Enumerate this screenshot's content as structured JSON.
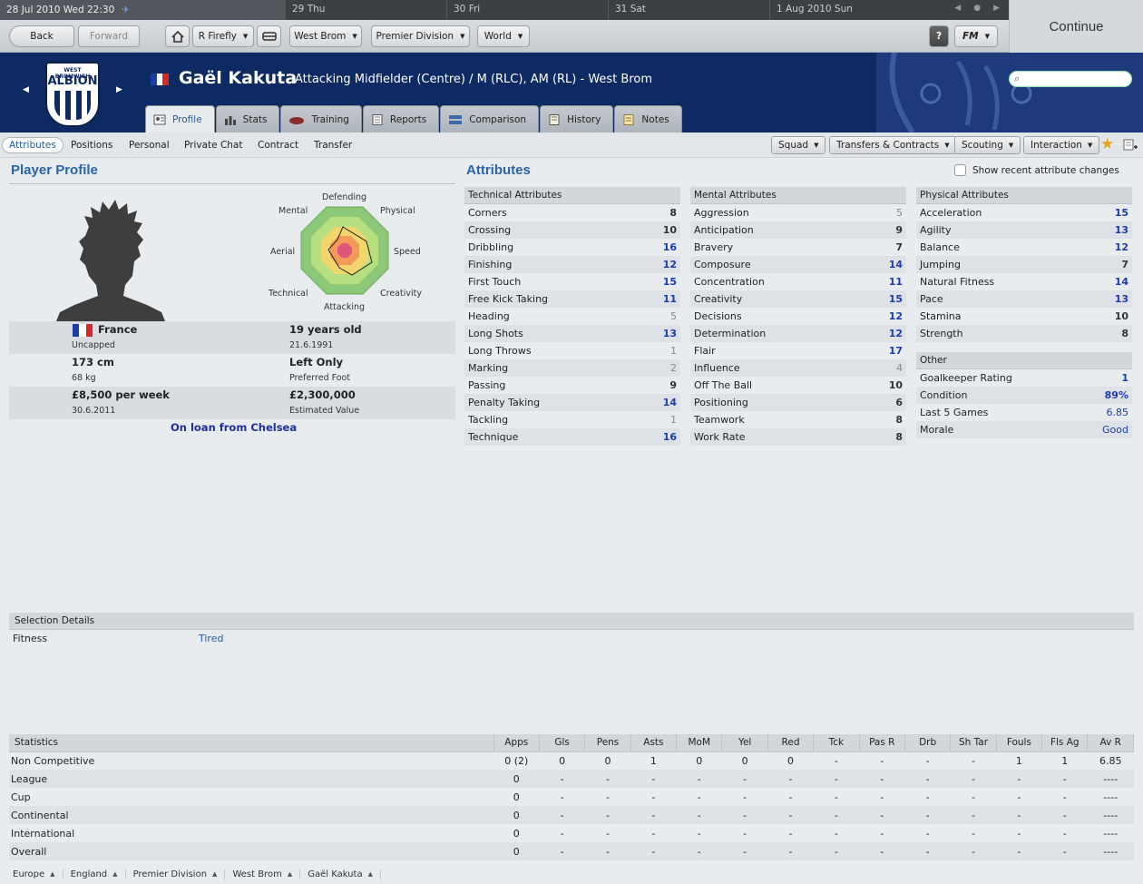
{
  "datebar": {
    "current": "28 Jul 2010 Wed 22:30",
    "days": [
      "29 Thu",
      "30 Fri",
      "31 Sat",
      "1 Aug 2010 Sun"
    ]
  },
  "continue_label": "Continue",
  "toolbar": {
    "back": "Back",
    "forward": "Forward",
    "manager": "R Firefly",
    "club": "West Brom",
    "league": "Premier Division",
    "world": "World",
    "help": "?",
    "fm": "FM"
  },
  "header": {
    "crest_top": "WEST BROMWICH",
    "crest_name": "ALBION",
    "player_name": "Gaël Kakuta",
    "position": "Attacking Midfielder (Centre) / M (RLC), AM (RL) - West Brom"
  },
  "tabs": [
    "Profile",
    "Stats",
    "Training",
    "Reports",
    "Comparison",
    "History",
    "Notes"
  ],
  "subtabs": [
    "Attributes",
    "Positions",
    "Personal",
    "Private Chat",
    "Contract",
    "Transfer"
  ],
  "actions": [
    "Squad",
    "Transfers & Contracts",
    "Scouting",
    "Interaction"
  ],
  "profile": {
    "title": "Player Profile",
    "radar_labels": [
      "Defending",
      "Physical",
      "Speed",
      "Creativity",
      "Attacking",
      "Technical",
      "Aerial",
      "Mental"
    ],
    "nation": "France",
    "caps": "Uncapped",
    "age": "19 years old",
    "dob": "21.6.1991",
    "height": "173 cm",
    "weight": "68 kg",
    "foot": "Left Only",
    "foot_label": "Preferred Foot",
    "wage": "£8,500 per week",
    "contract_end": "30.6.2011",
    "value": "£2,300,000",
    "value_label": "Estimated Value",
    "loan": "On loan from Chelsea"
  },
  "attributes": {
    "title": "Attributes",
    "show_recent": "Show recent attribute changes",
    "technical": {
      "header": "Technical Attributes",
      "rows": [
        [
          "Corners",
          "8"
        ],
        [
          "Crossing",
          "10"
        ],
        [
          "Dribbling",
          "16"
        ],
        [
          "Finishing",
          "12"
        ],
        [
          "First Touch",
          "15"
        ],
        [
          "Free Kick Taking",
          "11"
        ],
        [
          "Heading",
          "5"
        ],
        [
          "Long Shots",
          "13"
        ],
        [
          "Long Throws",
          "1"
        ],
        [
          "Marking",
          "2"
        ],
        [
          "Passing",
          "9"
        ],
        [
          "Penalty Taking",
          "14"
        ],
        [
          "Tackling",
          "1"
        ],
        [
          "Technique",
          "16"
        ]
      ]
    },
    "mental": {
      "header": "Mental Attributes",
      "rows": [
        [
          "Aggression",
          "5"
        ],
        [
          "Anticipation",
          "9"
        ],
        [
          "Bravery",
          "7"
        ],
        [
          "Composure",
          "14"
        ],
        [
          "Concentration",
          "11"
        ],
        [
          "Creativity",
          "15"
        ],
        [
          "Decisions",
          "12"
        ],
        [
          "Determination",
          "12"
        ],
        [
          "Flair",
          "17"
        ],
        [
          "Influence",
          "4"
        ],
        [
          "Off The Ball",
          "10"
        ],
        [
          "Positioning",
          "6"
        ],
        [
          "Teamwork",
          "8"
        ],
        [
          "Work Rate",
          "8"
        ]
      ]
    },
    "physical": {
      "header": "Physical Attributes",
      "rows": [
        [
          "Acceleration",
          "15"
        ],
        [
          "Agility",
          "13"
        ],
        [
          "Balance",
          "12"
        ],
        [
          "Jumping",
          "7"
        ],
        [
          "Natural Fitness",
          "14"
        ],
        [
          "Pace",
          "13"
        ],
        [
          "Stamina",
          "10"
        ],
        [
          "Strength",
          "8"
        ]
      ]
    },
    "other": {
      "header": "Other",
      "rows": [
        [
          "Goalkeeper Rating",
          "1"
        ],
        [
          "Condition",
          "89%"
        ],
        [
          "Last 5 Games",
          "6.85"
        ],
        [
          "Morale",
          "Good"
        ]
      ]
    }
  },
  "selection": {
    "header": "Selection Details",
    "label": "Fitness",
    "value": "Tired"
  },
  "statistics": {
    "columns": [
      "Statistics",
      "Apps",
      "Gls",
      "Pens",
      "Asts",
      "MoM",
      "Yel",
      "Red",
      "Tck",
      "Pas R",
      "Drb",
      "Sh Tar",
      "Fouls",
      "Fls Ag",
      "Av R"
    ],
    "rows": [
      [
        "Non Competitive",
        "0 (2)",
        "0",
        "0",
        "1",
        "0",
        "0",
        "0",
        "-",
        "-",
        "-",
        "-",
        "1",
        "1",
        "6.85"
      ],
      [
        "League",
        "0",
        "-",
        "-",
        "-",
        "-",
        "-",
        "-",
        "-",
        "-",
        "-",
        "-",
        "-",
        "-",
        "----"
      ],
      [
        "Cup",
        "0",
        "-",
        "-",
        "-",
        "-",
        "-",
        "-",
        "-",
        "-",
        "-",
        "-",
        "-",
        "-",
        "----"
      ],
      [
        "Continental",
        "0",
        "-",
        "-",
        "-",
        "-",
        "-",
        "-",
        "-",
        "-",
        "-",
        "-",
        "-",
        "-",
        "----"
      ],
      [
        "International",
        "0",
        "-",
        "-",
        "-",
        "-",
        "-",
        "-",
        "-",
        "-",
        "-",
        "-",
        "-",
        "-",
        "----"
      ],
      [
        "Overall",
        "0",
        "-",
        "-",
        "-",
        "-",
        "-",
        "-",
        "-",
        "-",
        "-",
        "-",
        "-",
        "-",
        "----"
      ]
    ]
  },
  "breadcrumb": [
    "Europe",
    "England",
    "Premier Division",
    "West Brom",
    "Gaël Kakuta"
  ]
}
